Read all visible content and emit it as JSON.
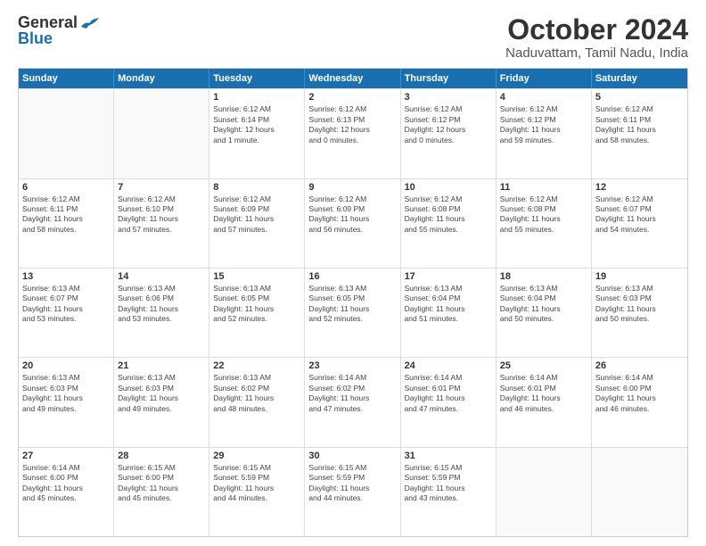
{
  "logo": {
    "general": "General",
    "blue": "Blue"
  },
  "title": "October 2024",
  "location": "Naduvattam, Tamil Nadu, India",
  "header_days": [
    "Sunday",
    "Monday",
    "Tuesday",
    "Wednesday",
    "Thursday",
    "Friday",
    "Saturday"
  ],
  "weeks": [
    [
      {
        "day": "",
        "lines": []
      },
      {
        "day": "",
        "lines": []
      },
      {
        "day": "1",
        "lines": [
          "Sunrise: 6:12 AM",
          "Sunset: 6:14 PM",
          "Daylight: 12 hours",
          "and 1 minute."
        ]
      },
      {
        "day": "2",
        "lines": [
          "Sunrise: 6:12 AM",
          "Sunset: 6:13 PM",
          "Daylight: 12 hours",
          "and 0 minutes."
        ]
      },
      {
        "day": "3",
        "lines": [
          "Sunrise: 6:12 AM",
          "Sunset: 6:12 PM",
          "Daylight: 12 hours",
          "and 0 minutes."
        ]
      },
      {
        "day": "4",
        "lines": [
          "Sunrise: 6:12 AM",
          "Sunset: 6:12 PM",
          "Daylight: 11 hours",
          "and 59 minutes."
        ]
      },
      {
        "day": "5",
        "lines": [
          "Sunrise: 6:12 AM",
          "Sunset: 6:11 PM",
          "Daylight: 11 hours",
          "and 58 minutes."
        ]
      }
    ],
    [
      {
        "day": "6",
        "lines": [
          "Sunrise: 6:12 AM",
          "Sunset: 6:11 PM",
          "Daylight: 11 hours",
          "and 58 minutes."
        ]
      },
      {
        "day": "7",
        "lines": [
          "Sunrise: 6:12 AM",
          "Sunset: 6:10 PM",
          "Daylight: 11 hours",
          "and 57 minutes."
        ]
      },
      {
        "day": "8",
        "lines": [
          "Sunrise: 6:12 AM",
          "Sunset: 6:09 PM",
          "Daylight: 11 hours",
          "and 57 minutes."
        ]
      },
      {
        "day": "9",
        "lines": [
          "Sunrise: 6:12 AM",
          "Sunset: 6:09 PM",
          "Daylight: 11 hours",
          "and 56 minutes."
        ]
      },
      {
        "day": "10",
        "lines": [
          "Sunrise: 6:12 AM",
          "Sunset: 6:08 PM",
          "Daylight: 11 hours",
          "and 55 minutes."
        ]
      },
      {
        "day": "11",
        "lines": [
          "Sunrise: 6:12 AM",
          "Sunset: 6:08 PM",
          "Daylight: 11 hours",
          "and 55 minutes."
        ]
      },
      {
        "day": "12",
        "lines": [
          "Sunrise: 6:12 AM",
          "Sunset: 6:07 PM",
          "Daylight: 11 hours",
          "and 54 minutes."
        ]
      }
    ],
    [
      {
        "day": "13",
        "lines": [
          "Sunrise: 6:13 AM",
          "Sunset: 6:07 PM",
          "Daylight: 11 hours",
          "and 53 minutes."
        ]
      },
      {
        "day": "14",
        "lines": [
          "Sunrise: 6:13 AM",
          "Sunset: 6:06 PM",
          "Daylight: 11 hours",
          "and 53 minutes."
        ]
      },
      {
        "day": "15",
        "lines": [
          "Sunrise: 6:13 AM",
          "Sunset: 6:05 PM",
          "Daylight: 11 hours",
          "and 52 minutes."
        ]
      },
      {
        "day": "16",
        "lines": [
          "Sunrise: 6:13 AM",
          "Sunset: 6:05 PM",
          "Daylight: 11 hours",
          "and 52 minutes."
        ]
      },
      {
        "day": "17",
        "lines": [
          "Sunrise: 6:13 AM",
          "Sunset: 6:04 PM",
          "Daylight: 11 hours",
          "and 51 minutes."
        ]
      },
      {
        "day": "18",
        "lines": [
          "Sunrise: 6:13 AM",
          "Sunset: 6:04 PM",
          "Daylight: 11 hours",
          "and 50 minutes."
        ]
      },
      {
        "day": "19",
        "lines": [
          "Sunrise: 6:13 AM",
          "Sunset: 6:03 PM",
          "Daylight: 11 hours",
          "and 50 minutes."
        ]
      }
    ],
    [
      {
        "day": "20",
        "lines": [
          "Sunrise: 6:13 AM",
          "Sunset: 6:03 PM",
          "Daylight: 11 hours",
          "and 49 minutes."
        ]
      },
      {
        "day": "21",
        "lines": [
          "Sunrise: 6:13 AM",
          "Sunset: 6:03 PM",
          "Daylight: 11 hours",
          "and 49 minutes."
        ]
      },
      {
        "day": "22",
        "lines": [
          "Sunrise: 6:13 AM",
          "Sunset: 6:02 PM",
          "Daylight: 11 hours",
          "and 48 minutes."
        ]
      },
      {
        "day": "23",
        "lines": [
          "Sunrise: 6:14 AM",
          "Sunset: 6:02 PM",
          "Daylight: 11 hours",
          "and 47 minutes."
        ]
      },
      {
        "day": "24",
        "lines": [
          "Sunrise: 6:14 AM",
          "Sunset: 6:01 PM",
          "Daylight: 11 hours",
          "and 47 minutes."
        ]
      },
      {
        "day": "25",
        "lines": [
          "Sunrise: 6:14 AM",
          "Sunset: 6:01 PM",
          "Daylight: 11 hours",
          "and 46 minutes."
        ]
      },
      {
        "day": "26",
        "lines": [
          "Sunrise: 6:14 AM",
          "Sunset: 6:00 PM",
          "Daylight: 11 hours",
          "and 46 minutes."
        ]
      }
    ],
    [
      {
        "day": "27",
        "lines": [
          "Sunrise: 6:14 AM",
          "Sunset: 6:00 PM",
          "Daylight: 11 hours",
          "and 45 minutes."
        ]
      },
      {
        "day": "28",
        "lines": [
          "Sunrise: 6:15 AM",
          "Sunset: 6:00 PM",
          "Daylight: 11 hours",
          "and 45 minutes."
        ]
      },
      {
        "day": "29",
        "lines": [
          "Sunrise: 6:15 AM",
          "Sunset: 5:59 PM",
          "Daylight: 11 hours",
          "and 44 minutes."
        ]
      },
      {
        "day": "30",
        "lines": [
          "Sunrise: 6:15 AM",
          "Sunset: 5:59 PM",
          "Daylight: 11 hours",
          "and 44 minutes."
        ]
      },
      {
        "day": "31",
        "lines": [
          "Sunrise: 6:15 AM",
          "Sunset: 5:59 PM",
          "Daylight: 11 hours",
          "and 43 minutes."
        ]
      },
      {
        "day": "",
        "lines": []
      },
      {
        "day": "",
        "lines": []
      }
    ]
  ]
}
